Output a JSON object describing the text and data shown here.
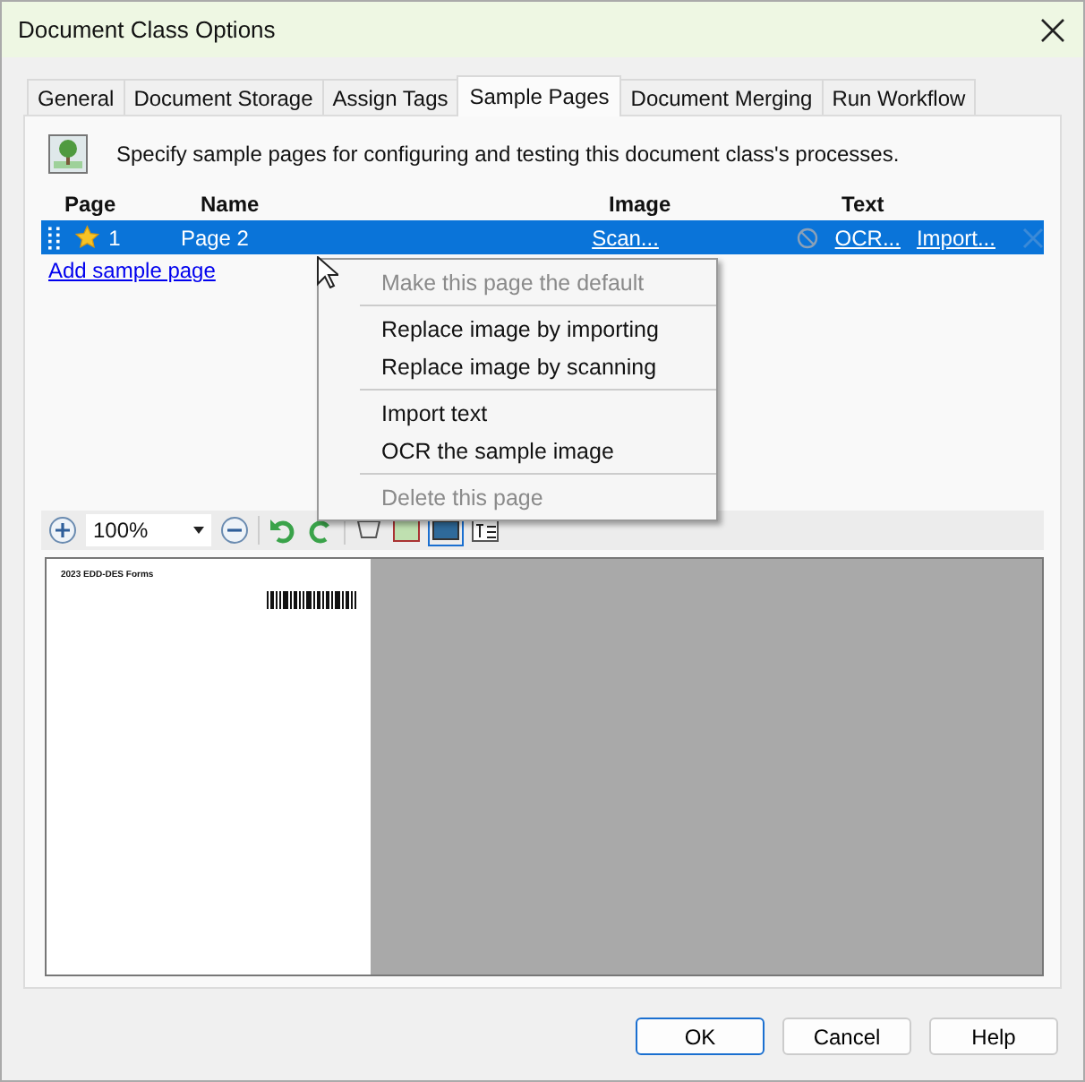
{
  "window": {
    "title": "Document Class Options"
  },
  "tabs": [
    {
      "label": "General",
      "selected": false
    },
    {
      "label": "Document Storage",
      "selected": false
    },
    {
      "label": "Assign Tags",
      "selected": false
    },
    {
      "label": "Sample Pages",
      "selected": true
    },
    {
      "label": "Document Merging",
      "selected": false
    },
    {
      "label": "Run Workflow",
      "selected": false
    }
  ],
  "description": "Specify sample pages for configuring and testing this document class's processes.",
  "table": {
    "columns": [
      "Page",
      "Name",
      "Image",
      "Text"
    ],
    "rows": [
      {
        "selected": true,
        "default": true,
        "page": "1",
        "name": "Page 2",
        "image_links": [
          "Scan..."
        ],
        "text_links": [
          "OCR...",
          "Import..."
        ]
      }
    ]
  },
  "add_link": "Add sample page",
  "toolbar": {
    "zoom": "100%"
  },
  "preview": {
    "header": "2023 EDD-DES Forms"
  },
  "context_menu": [
    {
      "label": "Make this page the default",
      "disabled": true,
      "separator_after": true
    },
    {
      "label": "Replace image by importing",
      "disabled": false,
      "separator_after": false
    },
    {
      "label": "Replace image by scanning",
      "disabled": false,
      "separator_after": true
    },
    {
      "label": "Import text",
      "disabled": false,
      "separator_after": false
    },
    {
      "label": "OCR the sample image",
      "disabled": false,
      "separator_after": true
    },
    {
      "label": "Delete this page",
      "disabled": true,
      "separator_after": false
    }
  ],
  "buttons": [
    {
      "label": "OK",
      "default": true
    },
    {
      "label": "Cancel",
      "default": false
    },
    {
      "label": "Help",
      "default": false
    }
  ]
}
